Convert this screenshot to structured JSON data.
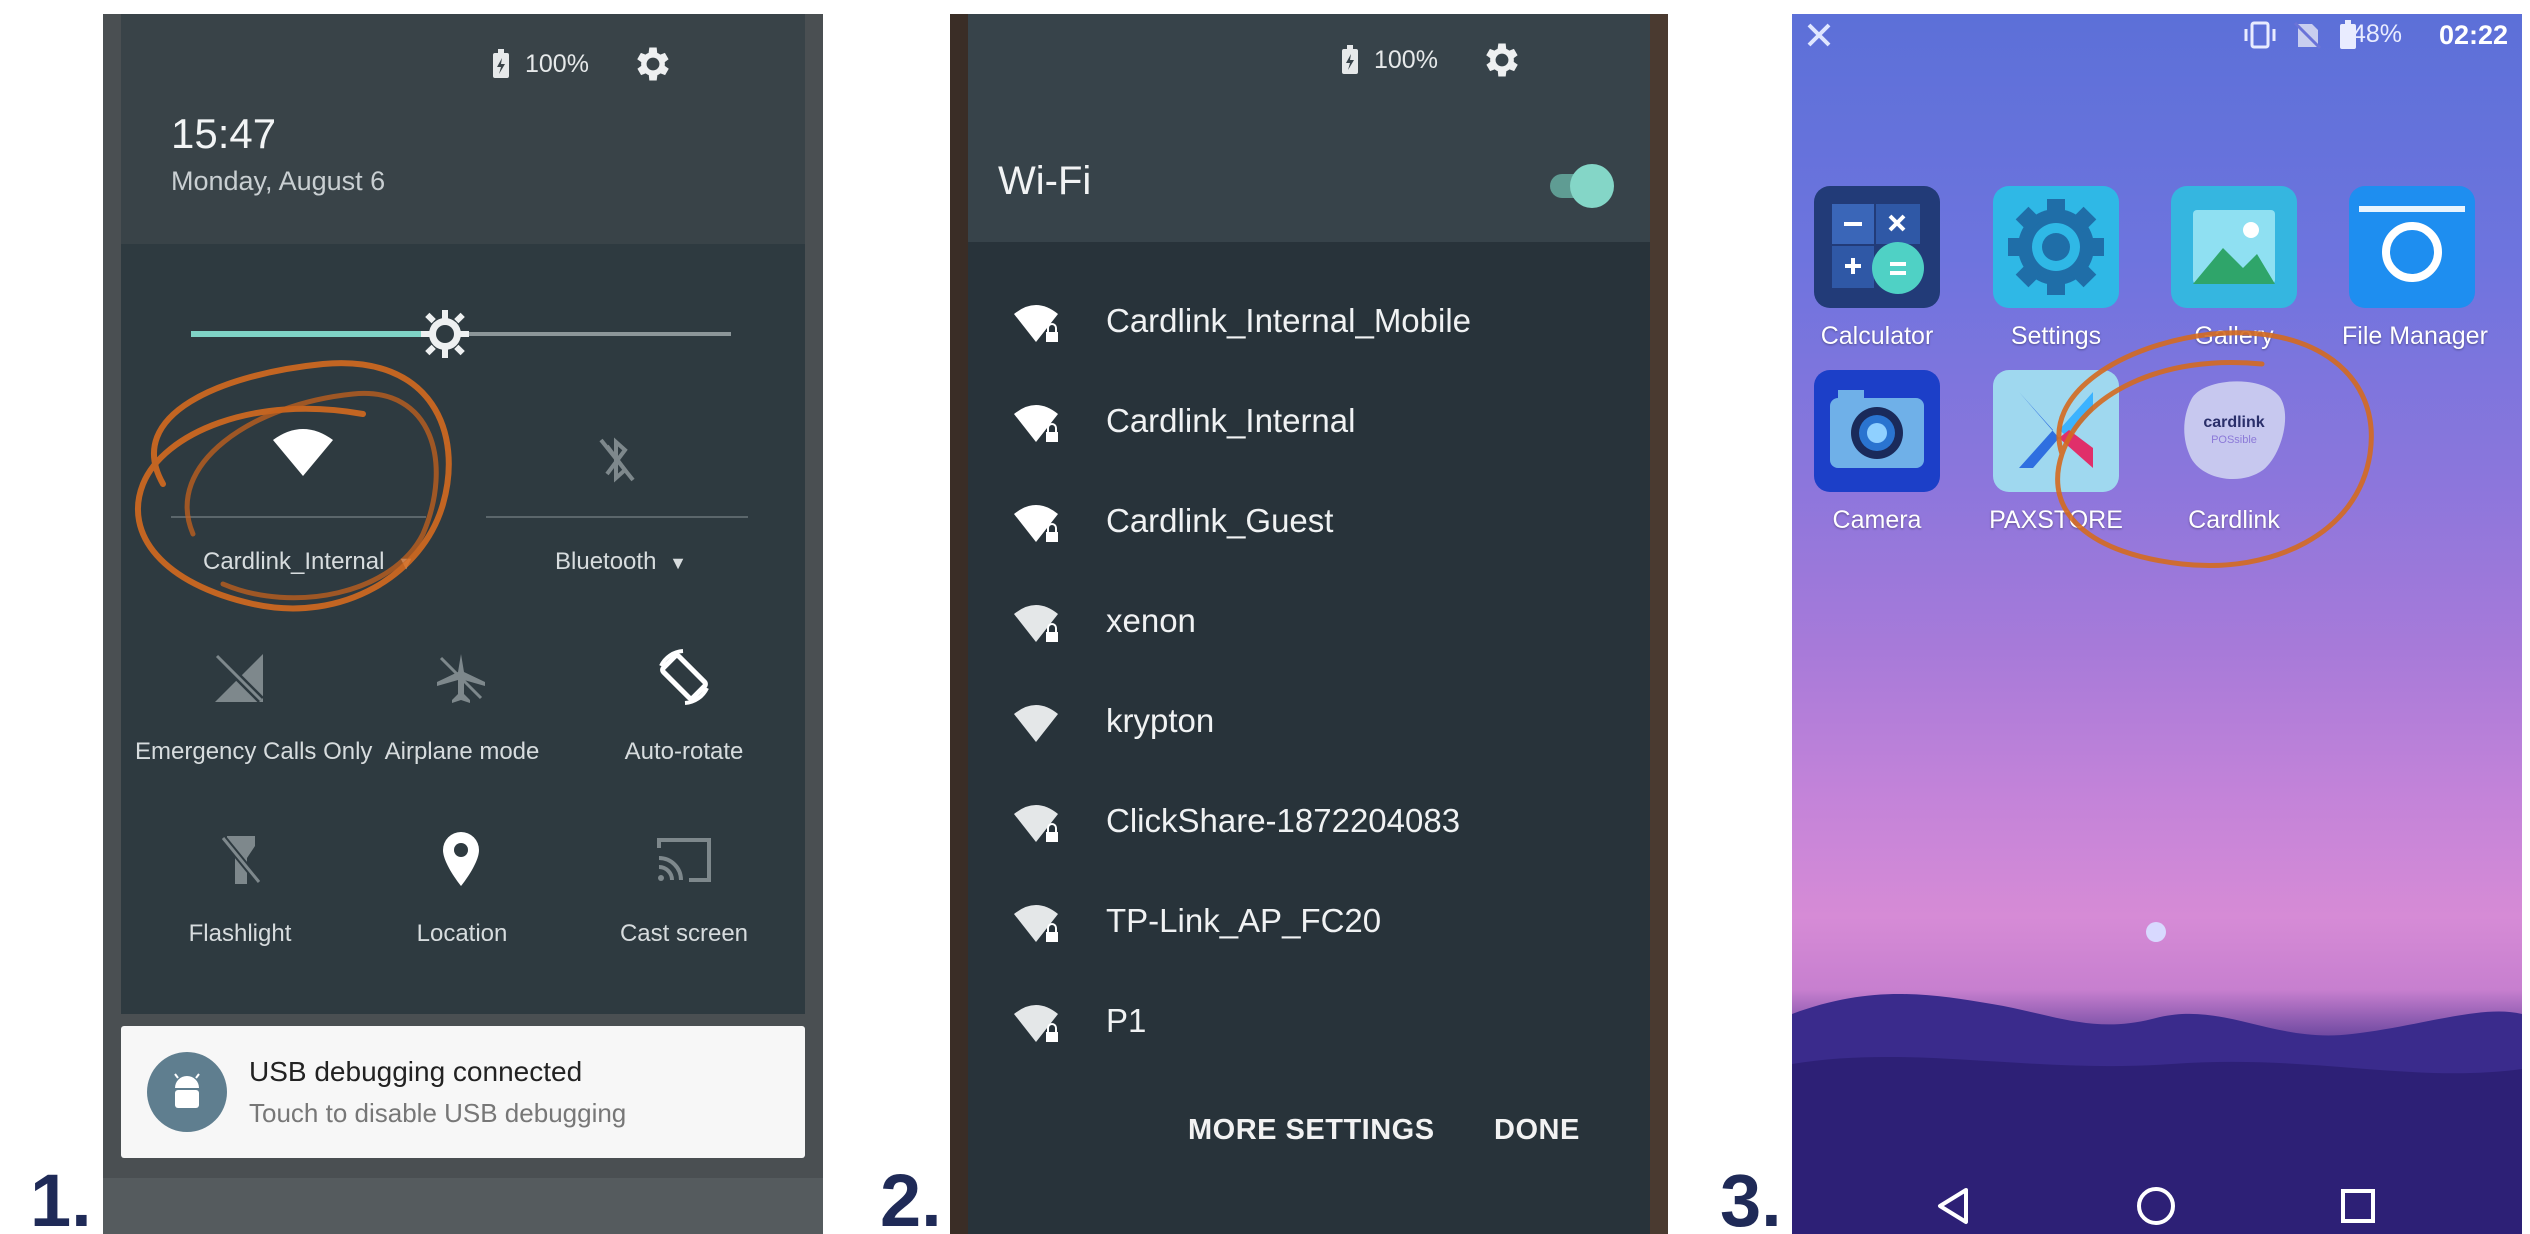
{
  "steps": [
    "1.",
    "2.",
    "3."
  ],
  "panel1": {
    "battery": "100%",
    "time": "15:47",
    "date": "Monday, August 6",
    "tiles": {
      "wifi": "Cardlink_Internal",
      "bluetooth": "Bluetooth",
      "emergency": "Emergency Calls Only",
      "airplane": "Airplane mode",
      "autorotate": "Auto-rotate",
      "flashlight": "Flashlight",
      "location": "Location",
      "cast": "Cast screen"
    },
    "notification": {
      "title": "USB debugging connected",
      "text": "Touch to disable USB debugging"
    }
  },
  "panel2": {
    "battery": "100%",
    "title": "Wi-Fi",
    "toggle_on": true,
    "networks": [
      {
        "name": "Cardlink_Internal_Mobile",
        "locked": true
      },
      {
        "name": "Cardlink_Internal",
        "locked": true
      },
      {
        "name": "Cardlink_Guest",
        "locked": true
      },
      {
        "name": "xenon",
        "locked": true
      },
      {
        "name": "krypton",
        "locked": false
      },
      {
        "name": "ClickShare-1872204083",
        "locked": true
      },
      {
        "name": "TP-Link_AP_FC20",
        "locked": true
      },
      {
        "name": "P1",
        "locked": true
      }
    ],
    "more_settings": "MORE SETTINGS",
    "done": "DONE"
  },
  "panel3": {
    "battery": "48%",
    "time": "02:22",
    "apps": {
      "calculator": "Calculator",
      "settings": "Settings",
      "gallery": "Gallery",
      "file_manager": "File Manager",
      "camera": "Camera",
      "paxstore": "PAXSTORE",
      "cardlink": "Cardlink"
    },
    "cardlink_logo_line1": "cardlink",
    "cardlink_logo_line2": "POSsible"
  },
  "colors": {
    "accent_teal": "#7fd3c6",
    "annotation_orange": "#d46a1f",
    "step_number": "#1f2a57"
  }
}
